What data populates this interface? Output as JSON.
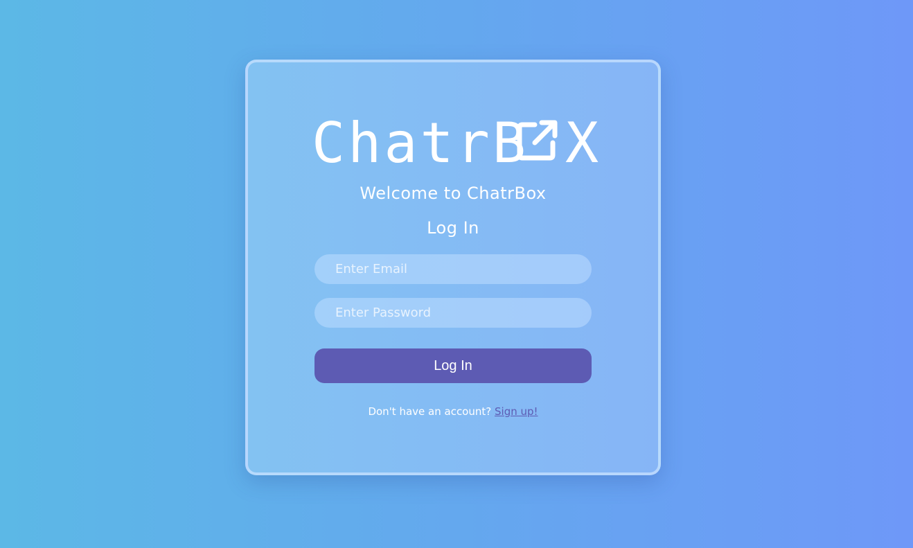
{
  "logo": {
    "text_left": "ChatrB",
    "text_right": "X",
    "icon": "external-link-box-icon"
  },
  "welcome": "Welcome to ChatrBox",
  "form": {
    "heading": "Log In",
    "email_placeholder": "Enter Email",
    "password_placeholder": "Enter Password",
    "submit_label": "Log In"
  },
  "signup": {
    "prompt": "Don't have an account?",
    "link_label": "Sign up!"
  },
  "colors": {
    "background_start": "#5cb8e6",
    "background_end": "#6e98f8",
    "button": "#5d5bb3",
    "link": "#5d5bb3"
  }
}
